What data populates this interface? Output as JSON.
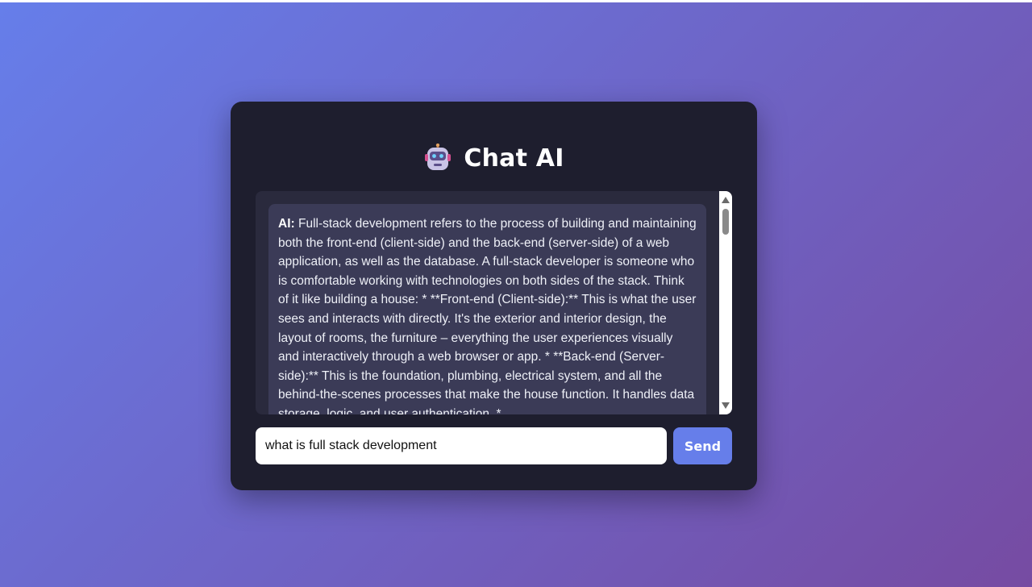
{
  "app": {
    "title": "Chat AI"
  },
  "icons": {
    "title_icon": "robot-icon",
    "scroll_up": "triangle-up-icon",
    "scroll_down": "triangle-down-icon"
  },
  "colors": {
    "background_start": "#667eea",
    "background_end": "#764ba2",
    "card": "#1e1e2e",
    "chat_area": "#2a2a3d",
    "message_bubble": "#3b3b57",
    "accent": "#667eea"
  },
  "chat": {
    "messages": [
      {
        "sender": "AI:",
        "text": "Full-stack development refers to the process of building and maintaining both the front-end (client-side) and the back-end (server-side) of a web application, as well as the database. A full-stack developer is someone who is comfortable working with technologies on both sides of the stack. Think of it like building a house: * **Front-end (Client-side):** This is what the user sees and interacts with directly. It's the exterior and interior design, the layout of rooms, the furniture – everything the user experiences visually and interactively through a web browser or app. * **Back-end (Server-side):** This is the foundation, plumbing, electrical system, and all the behind-the-scenes processes that make the house function. It handles data storage, logic, and user authentication. *"
      }
    ]
  },
  "input": {
    "value": "what is full stack development"
  },
  "send": {
    "label": "Send"
  }
}
